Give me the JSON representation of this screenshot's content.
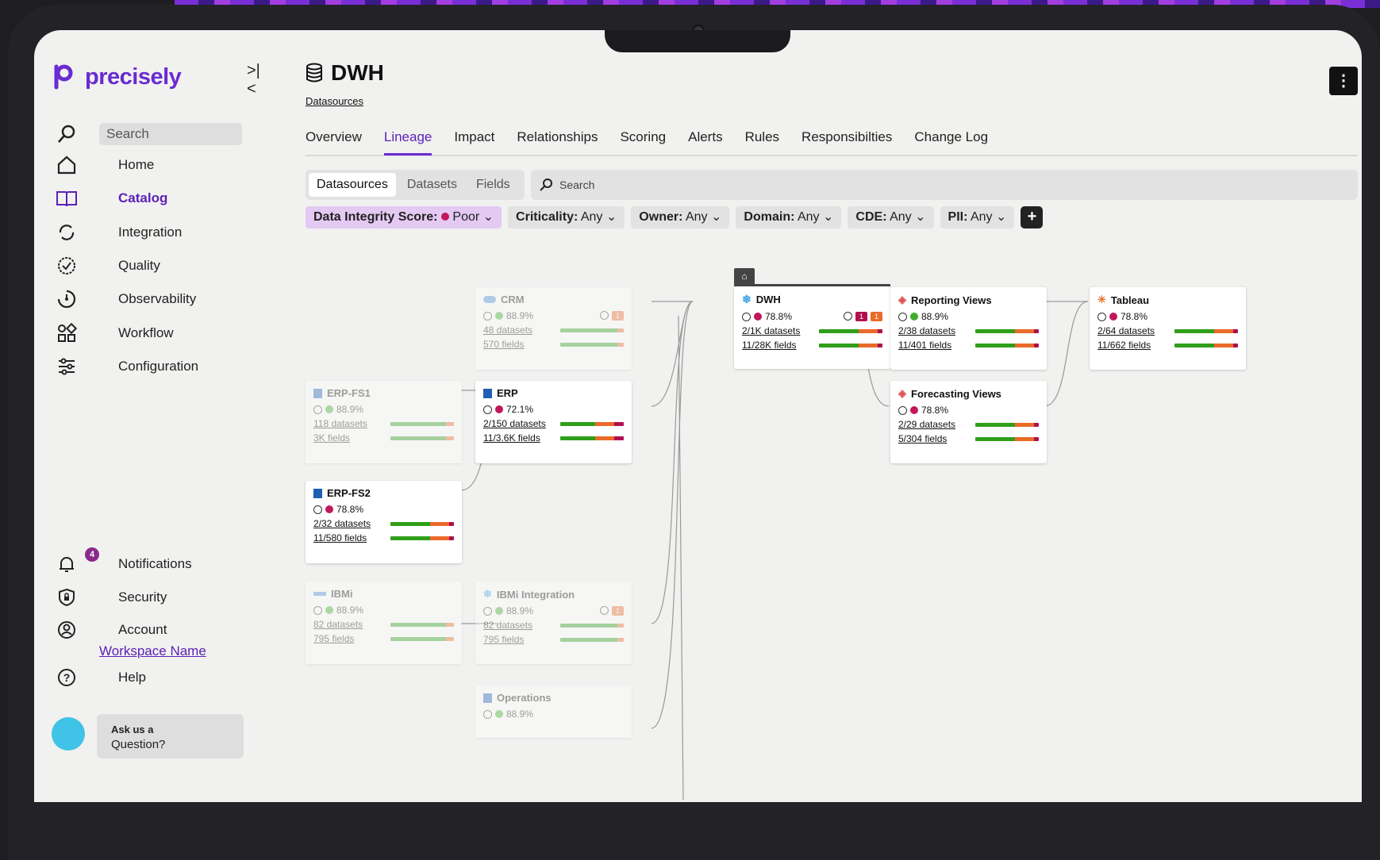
{
  "app": {
    "name": "precisely"
  },
  "sidebar": {
    "search_placeholder": "Search",
    "items": [
      {
        "label": "Home",
        "icon": "home-icon"
      },
      {
        "label": "Catalog",
        "icon": "book-icon",
        "active": true
      },
      {
        "label": "Integration",
        "icon": "integration-icon"
      },
      {
        "label": "Quality",
        "icon": "quality-icon"
      },
      {
        "label": "Observability",
        "icon": "observability-icon"
      },
      {
        "label": "Workflow",
        "icon": "workflow-icon"
      },
      {
        "label": "Configuration",
        "icon": "sliders-icon"
      }
    ],
    "bottom": {
      "notifications": {
        "label": "Notifications",
        "count": "4"
      },
      "security": {
        "label": "Security"
      },
      "account": {
        "label": "Account",
        "workspace": "Workspace Name"
      },
      "help": {
        "label": "Help"
      }
    },
    "ask": {
      "line1": "Ask us a",
      "line2": "Question?"
    }
  },
  "header": {
    "title": "DWH",
    "breadcrumb": "Datasources",
    "tabs": [
      "Overview",
      "Lineage",
      "Impact",
      "Relationships",
      "Scoring",
      "Alerts",
      "Rules",
      "Responsibilties",
      "Change Log"
    ],
    "active_tab": "Lineage"
  },
  "toolbar": {
    "segments": [
      "Datasources",
      "Datasets",
      "Fields"
    ],
    "active_segment": "Datasources",
    "search_placeholder": "Search",
    "filters": [
      {
        "label": "Data Integrity Score:",
        "value": "Poor"
      },
      {
        "label": "Criticality:",
        "value": "Any"
      },
      {
        "label": "Owner:",
        "value": "Any"
      },
      {
        "label": "Domain:",
        "value": "Any"
      },
      {
        "label": "CDE:",
        "value": "Any"
      },
      {
        "label": "PII:",
        "value": "Any"
      }
    ]
  },
  "nodes": {
    "crm": {
      "name": "CRM",
      "score": "88.9%",
      "datasets": "48 datasets",
      "fields": "570 fields",
      "tag2": "1"
    },
    "erp_fs1": {
      "name": "ERP-FS1",
      "score": "88.9%",
      "datasets": "118 datasets",
      "fields": "3K fields"
    },
    "erp": {
      "name": "ERP",
      "score": "72.1%",
      "datasets": "2/150 datasets",
      "fields": "11/3.6K fields"
    },
    "erp_fs2": {
      "name": "ERP-FS2",
      "score": "78.8%",
      "datasets": "2/32 datasets",
      "fields": "11/580 fields"
    },
    "dwh": {
      "name": "DWH",
      "score": "78.8%",
      "datasets": "2/1K datasets",
      "fields": "11/28K fields",
      "tag1": "1",
      "tag2": "1"
    },
    "reporting": {
      "name": "Reporting Views",
      "score": "88.9%",
      "datasets": "2/38 datasets",
      "fields": "11/401 fields"
    },
    "forecasting": {
      "name": "Forecasting Views",
      "score": "78.8%",
      "datasets": "2/29 datasets",
      "fields": "5/304 fields"
    },
    "tableau": {
      "name": "Tableau",
      "score": "78.8%",
      "datasets": "2/64 datasets",
      "fields": "11/662 fields"
    },
    "ibmi": {
      "name": "IBMi",
      "score": "88.9%",
      "datasets": "82 datasets",
      "fields": "795 fields"
    },
    "ibmi_int": {
      "name": "IBMi Integration",
      "score": "88.9%",
      "datasets": "82 datasets",
      "fields": "795 fields",
      "tag2": "1"
    },
    "operations": {
      "name": "Operations",
      "score": "88.9%"
    }
  },
  "colors": {
    "brand": "#6a2bd0",
    "good": "#3fae2a",
    "bad": "#c2185b",
    "warn": "#ea6a2a"
  }
}
